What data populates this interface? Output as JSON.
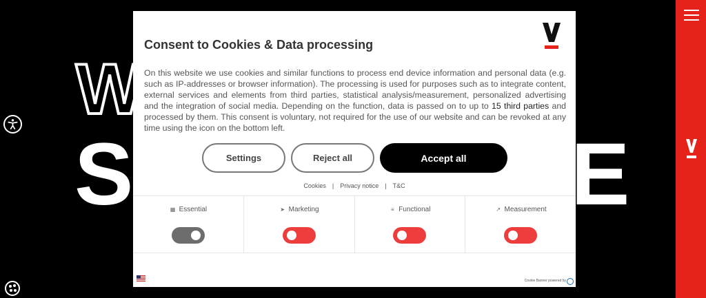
{
  "background": {
    "hero_outline_text": "W",
    "hero_solid_left": "S",
    "hero_solid_right": "E"
  },
  "rail": {
    "color": "#e5231b",
    "menu_icon": "hamburger-icon",
    "logo": "brand-v-logo"
  },
  "left_tools": {
    "accessibility_icon": "accessibility-icon",
    "cookie_icon": "cookie-icon"
  },
  "modal": {
    "title": "Consent to Cookies & Data processing",
    "text_before_link": "On this website we use cookies and similar functions to process end device information and personal data (e.g. such as IP-addresses or browser information). The processing is used for purposes such as to integrate content, external services and elements from third parties, statistical analysis/measurement, personalized advertising and the integration of social media. Depending on the function, data is passed on to up to ",
    "third_parties_link": "15 third parties",
    "text_after_link": " and processed by them. This consent is voluntary, not required for the use of our website and can be revoked at any time using the icon on the bottom left.",
    "buttons": {
      "settings": "Settings",
      "reject": "Reject all",
      "accept": "Accept all"
    },
    "links": {
      "cookies": "Cookies",
      "privacy": "Privacy notice",
      "tc": "T&C",
      "separator": "|"
    },
    "categories": [
      {
        "label": "Essential",
        "icon": "essential-icon",
        "enabled": true
      },
      {
        "label": "Marketing",
        "icon": "marketing-icon",
        "enabled": false
      },
      {
        "label": "Functional",
        "icon": "functional-icon",
        "enabled": false
      },
      {
        "label": "Measurement",
        "icon": "measurement-icon",
        "enabled": false
      }
    ],
    "language_flag": "us-flag-icon",
    "powered_by": "Cookie Banner powered by"
  }
}
